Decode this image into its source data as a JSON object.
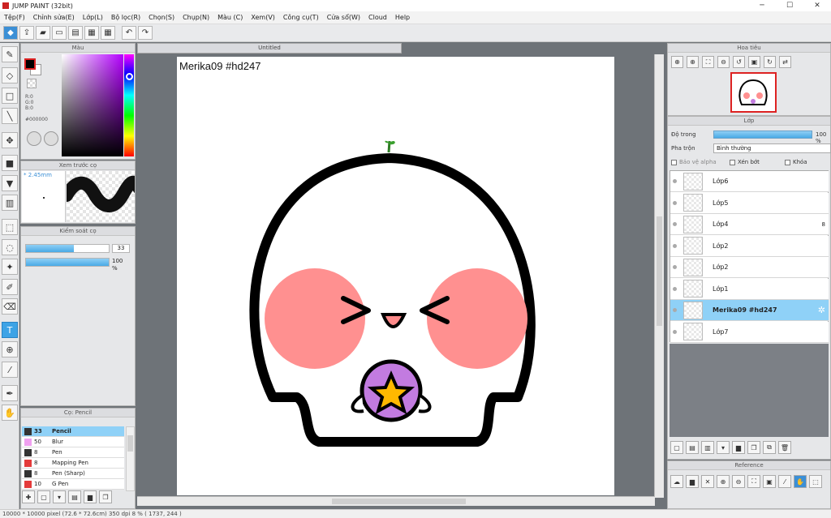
{
  "window": {
    "title": "JUMP PAINT (32bit)",
    "min": "─",
    "max": "☐",
    "close": "✕"
  },
  "menu": [
    "Tệp(F)",
    "Chỉnh sửa(E)",
    "Lớp(L)",
    "Bộ lọc(R)",
    "Chọn(S)",
    "Chụp(N)",
    "Màu (C)",
    "Xem(V)",
    "Công cụ(T)",
    "Cửa sổ(W)",
    "Cloud",
    "Help"
  ],
  "document": {
    "tab_title": "Untitled",
    "caption": "Merika09  #hd247"
  },
  "panels": {
    "color": {
      "title": "Màu",
      "r": "R:0",
      "g": "G:0",
      "b": "B:0",
      "hex": "#000000",
      "accent_hue": "#b400ff"
    },
    "brush_preview": {
      "title": "Xem trước cọ",
      "size": "* 2.45mm"
    },
    "brush_control": {
      "title": "Kiểm soát cọ",
      "size_value": "33",
      "size_level": 0.58,
      "opacity_value": "100 %",
      "opacity_level": 1.0
    },
    "pens": {
      "title": "Cọ: Pencil",
      "items": [
        {
          "num": "33",
          "name": "Pencil",
          "color": "#333333"
        },
        {
          "num": "50",
          "name": "Blur",
          "color": "#f0a0f0"
        },
        {
          "num": "8",
          "name": "Pen",
          "color": "#333333"
        },
        {
          "num": "8",
          "name": "Mapping Pen",
          "color": "#e43b3b"
        },
        {
          "num": "8",
          "name": "Pen (Sharp)",
          "color": "#333333"
        },
        {
          "num": "10",
          "name": "G Pen",
          "color": "#e43b3b"
        }
      ]
    },
    "navigator": {
      "title": "Hoa tiêu"
    },
    "layers": {
      "title": "Lớp",
      "opacity_label": "Độ trong",
      "opacity_value": "100 %",
      "blend_label": "Pha trộn",
      "blend_value": "Bình thường",
      "protect_alpha": "Bảo vệ alpha",
      "clipping": "Xén bớt",
      "lock": "Khóa",
      "items": [
        {
          "name": "Lớp6"
        },
        {
          "name": "Lớp5"
        },
        {
          "name": "Lớp4",
          "badge": "8"
        },
        {
          "name": "Lớp2"
        },
        {
          "name": "Lớp2"
        },
        {
          "name": "Lớp1"
        },
        {
          "name": "Merika09  #hd247",
          "selected": true
        },
        {
          "name": "Lớp7"
        }
      ]
    },
    "reference": {
      "title": "Reference"
    }
  },
  "status": "10000 * 10000 pixel   (72.6 * 72.6cm)   350 dpi   8 %   ( 1737, 244 )"
}
